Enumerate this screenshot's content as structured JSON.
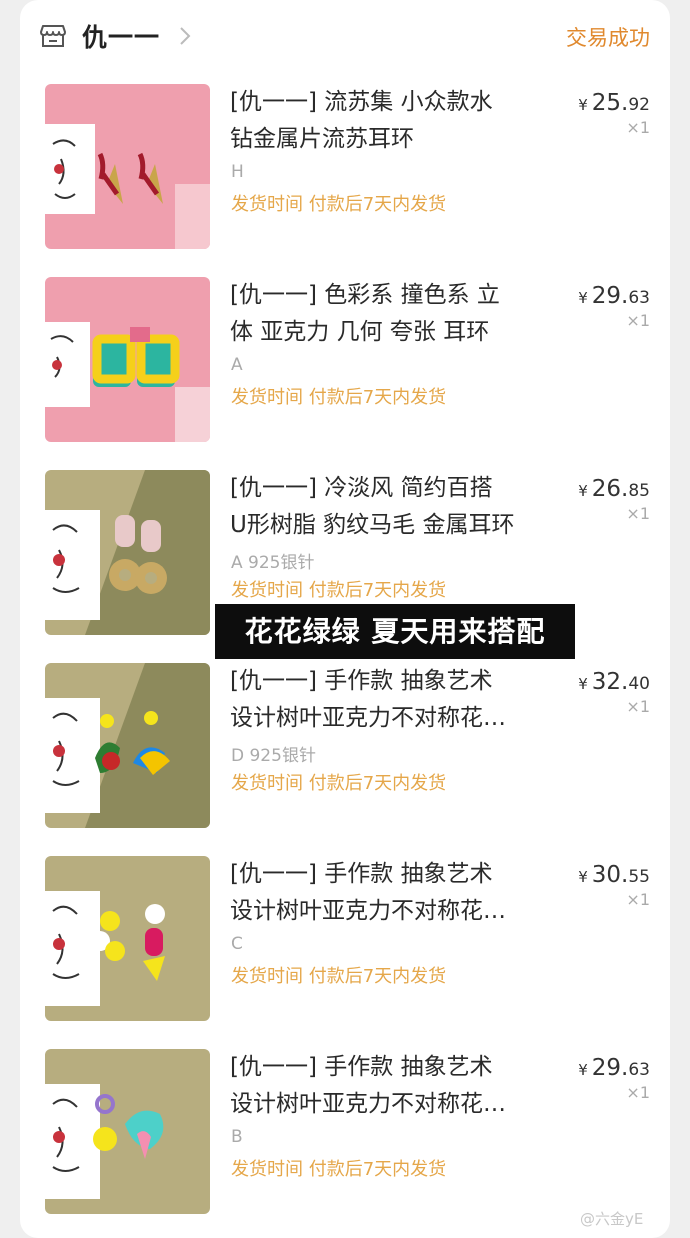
{
  "header": {
    "shop_name": "仇一一",
    "status": "交易成功"
  },
  "items": [
    {
      "title_line1": "[仇一一]  流苏集 小众款水",
      "title_line2": "钻金属片流苏耳环",
      "sku": "H",
      "shipping": "发货时间  付款后7天内发货",
      "price_yen": "¥",
      "price_int": "25.",
      "price_dec": "92",
      "qty": "×1",
      "bg": "#ef9fae"
    },
    {
      "title_line1": "[仇一一]  色彩系 撞色系 立",
      "title_line2": "体 亚克力 几何 夸张 耳环",
      "sku": "A",
      "shipping": "发货时间  付款后7天内发货",
      "price_yen": "¥",
      "price_int": "29.",
      "price_dec": "63",
      "qty": "×1",
      "bg": "#ef9fae"
    },
    {
      "title_line1": "[仇一一]  冷淡风 简约百搭",
      "title_line2": "U形树脂 豹纹马毛 金属耳环",
      "sku": "A   925银针",
      "shipping": "发货时间  付款后7天内发货",
      "price_yen": "¥",
      "price_int": "26.",
      "price_dec": "85",
      "qty": "×1",
      "bg": "#b7ad7f"
    },
    {
      "title_line1": "[仇一一]  手作款 抽象艺术",
      "title_line2": "设计树叶亚克力不对称花…",
      "sku": "D   925银针",
      "shipping": "发货时间  付款后7天内发货",
      "price_yen": "¥",
      "price_int": "32.",
      "price_dec": "40",
      "qty": "×1",
      "bg": "#b7ad7f"
    },
    {
      "title_line1": "[仇一一]  手作款 抽象艺术",
      "title_line2": "设计树叶亚克力不对称花…",
      "sku": "C",
      "shipping": "发货时间  付款后7天内发货",
      "price_yen": "¥",
      "price_int": "30.",
      "price_dec": "55",
      "qty": "×1",
      "bg": "#b7ad7f"
    },
    {
      "title_line1": "[仇一一]  手作款 抽象艺术",
      "title_line2": "设计树叶亚克力不对称花…",
      "sku": "B",
      "shipping": "发货时间  付款后7天内发货",
      "price_yen": "¥",
      "price_int": "29.",
      "price_dec": "63",
      "qty": "×1",
      "bg": "#b7ad7f"
    }
  ],
  "overlay_caption": "花花绿绿 夏天用来搭配",
  "watermark": "@六金yE",
  "colors": {
    "status": "#e0892e",
    "shipping": "#e5a74a"
  }
}
